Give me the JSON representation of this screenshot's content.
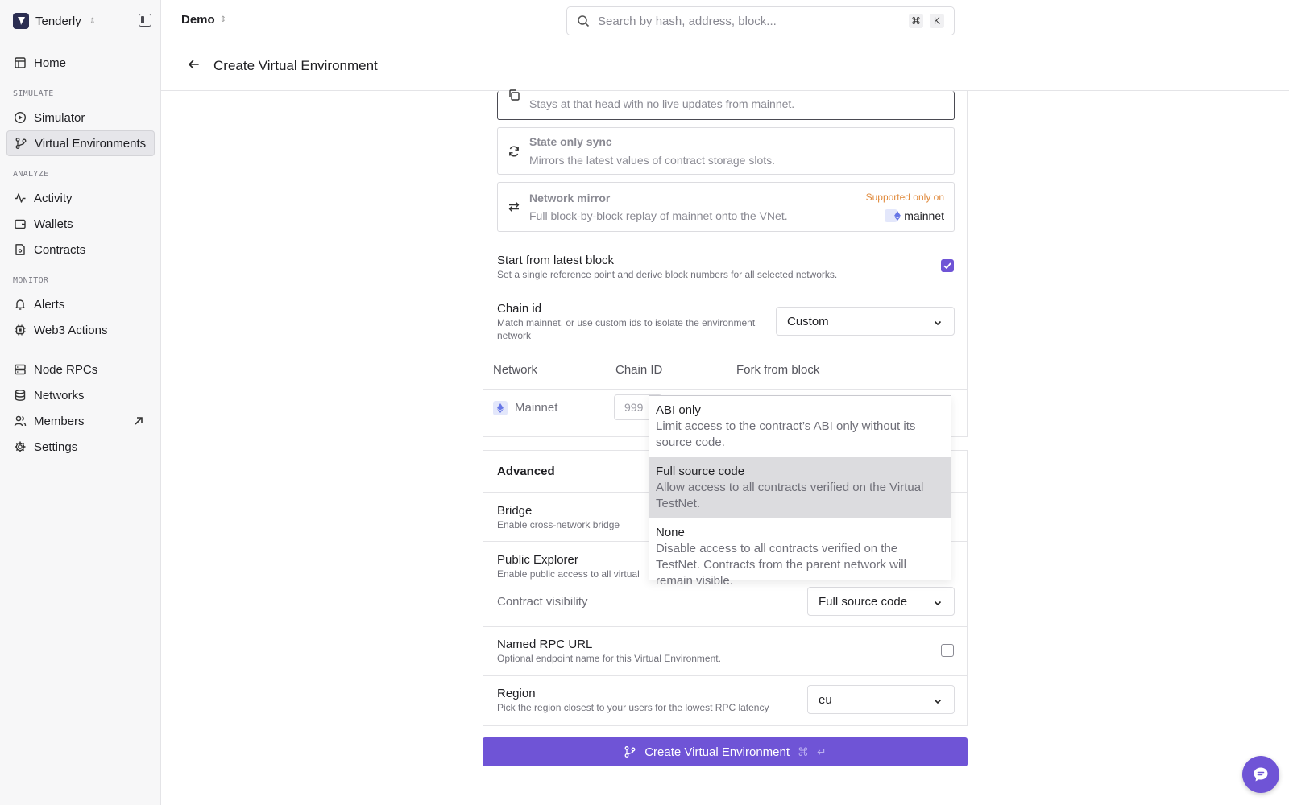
{
  "org": {
    "name": "Tenderly"
  },
  "project": {
    "name": "Demo"
  },
  "search": {
    "placeholder": "Search by hash, address, block...",
    "shortcut_cmd": "⌘",
    "shortcut_key": "K"
  },
  "sidebar": {
    "home": "Home",
    "simulate_label": "SIMULATE",
    "simulator": "Simulator",
    "virtual_environments": "Virtual Environments",
    "analyze_label": "ANALYZE",
    "activity": "Activity",
    "wallets": "Wallets",
    "contracts": "Contracts",
    "monitor_label": "MONITOR",
    "alerts": "Alerts",
    "web3_actions": "Web3 Actions",
    "node_rpcs": "Node RPCs",
    "networks": "Networks",
    "members": "Members",
    "settings": "Settings"
  },
  "page": {
    "title": "Create Virtual Environment"
  },
  "sync_options": {
    "static": {
      "description": "Stays at that head with no live updates from mainnet."
    },
    "state_only": {
      "title": "State only sync",
      "description": "Mirrors the latest values of contract storage slots."
    },
    "network_mirror": {
      "title": "Network mirror",
      "description": "Full block-by-block replay of mainnet onto the VNet.",
      "supported_label": "Supported only on",
      "supported_network": "mainnet"
    }
  },
  "start_latest": {
    "title": "Start from latest block",
    "subtitle": "Set a single reference point and derive block numbers for all selected networks.",
    "checked": true
  },
  "chain_id": {
    "title": "Chain id",
    "subtitle": "Match mainnet, or use custom ids to isolate the environment network",
    "selected": "Custom"
  },
  "network_table": {
    "headers": [
      "Network",
      "Chain ID",
      "Fork from block"
    ],
    "rows": [
      {
        "network": "Mainnet",
        "chain_id": "999"
      }
    ]
  },
  "advanced": {
    "title": "Advanced",
    "bridge": {
      "title": "Bridge",
      "subtitle": "Enable cross-network bridge"
    },
    "public_explorer": {
      "title": "Public Explorer",
      "subtitle": "Enable public access to all virtual"
    },
    "contract_visibility": {
      "label": "Contract visibility",
      "selected": "Full source code"
    },
    "named_rpc": {
      "title": "Named RPC URL",
      "subtitle": "Optional endpoint name for this Virtual Environment.",
      "checked": false
    },
    "region": {
      "title": "Region",
      "subtitle": "Pick the region closest to your users for the lowest RPC latency",
      "selected": "eu"
    }
  },
  "visibility_dropdown": {
    "options": [
      {
        "title": "ABI only",
        "description": "Limit access to the contract’s ABI only without its source code."
      },
      {
        "title": "Full source code",
        "description": "Allow access to all contracts verified on the Virtual TestNet.",
        "highlighted": true
      },
      {
        "title": "None",
        "description": "Disable access to all contracts verified on the TestNet. Contracts from the parent network will remain visible."
      }
    ]
  },
  "submit": {
    "label": "Create Virtual Environment",
    "shortcut_cmd": "⌘",
    "shortcut_enter": "↵"
  },
  "colors": {
    "accent": "#6f54d6",
    "supported": "#e08a3c",
    "eth_badge": "#e3e7fb"
  }
}
